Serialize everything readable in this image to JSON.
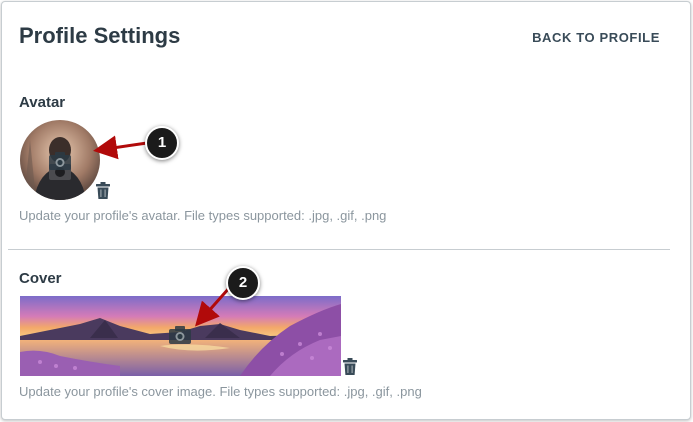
{
  "header": {
    "title": "Profile Settings",
    "back_link": "BACK TO PROFILE"
  },
  "avatar_section": {
    "label": "Avatar",
    "help_text": "Update your profile's avatar. File types supported: .jpg, .gif, .png"
  },
  "cover_section": {
    "label": "Cover",
    "help_text": "Update your profile's cover image. File types supported: .jpg, .gif, .png"
  },
  "callouts": [
    "1",
    "2"
  ],
  "colors": {
    "title": "#2d3b45",
    "muted": "#8b969e",
    "arrow": "#b10a0a",
    "icon": "#394b58"
  },
  "icons": [
    "camera-icon",
    "trash-icon"
  ]
}
